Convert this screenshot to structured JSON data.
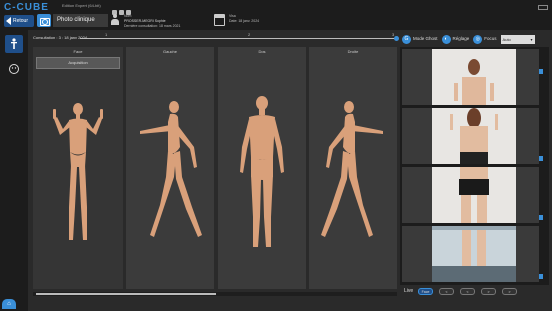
{
  "app": {
    "brand": "C-CUBE",
    "edition": "Edition Expert (64-bit)"
  },
  "header": {
    "back_label": "Retour",
    "page_title": "Photo clinique",
    "patient_label": "Nom",
    "patient_name": "PROSSER-MEGRI Sophie",
    "consult_date_label": "Dernière consultation: 18 mars 2021",
    "visit_label": "Visa",
    "visit_date": "Date: 18 janv. 2024"
  },
  "consultation": {
    "label": "Consultation : 3 : 18 janv 2024",
    "steps": [
      "1",
      "2",
      "3"
    ]
  },
  "modes": {
    "ghost_label": "Mode Ghost",
    "reglage_label": "Réglage",
    "focus_label": "Focus",
    "select_value": "Auto"
  },
  "panels": {
    "face": "Face",
    "acquisition": "Acquisition",
    "gauche": "Gauche",
    "dos": "Dos",
    "droite": "Droite"
  },
  "live": {
    "label": "Live",
    "buttons": [
      "Face",
      "<",
      "<",
      ">",
      ">"
    ]
  },
  "colors": {
    "accent": "#3a8fd8",
    "skin": "#d9a07a"
  }
}
